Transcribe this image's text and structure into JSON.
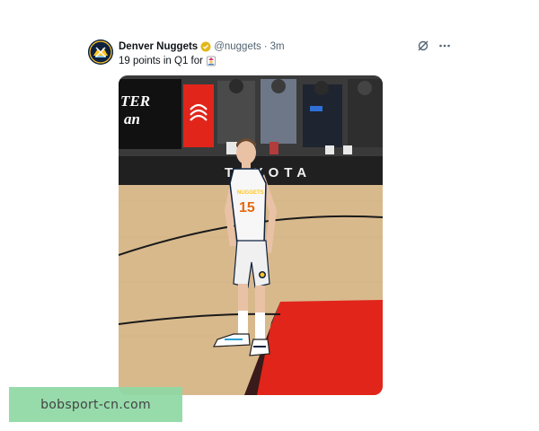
{
  "tweet": {
    "display_name": "Denver Nuggets",
    "handle": "@nuggets",
    "separator": "·",
    "time": "3m",
    "text": "19 points in Q1 for",
    "text_emoji_icon": "joker-emoji-icon",
    "verified_icon": "verified-badge-icon",
    "actions": [
      "grok-icon",
      "more-icon"
    ]
  },
  "media": {
    "jersey_number": "15",
    "jersey_text": "NUGGETS",
    "court_banner_text": "TOYOTA",
    "board_text_1": "TER",
    "board_text_2": "an"
  },
  "watermark": {
    "text": "bobsport-cn.com"
  },
  "colors": {
    "nuggets_navy": "#0e2240",
    "nuggets_gold": "#fec524",
    "court_red": "#e1251b",
    "court_wood": "#d8b98c"
  }
}
